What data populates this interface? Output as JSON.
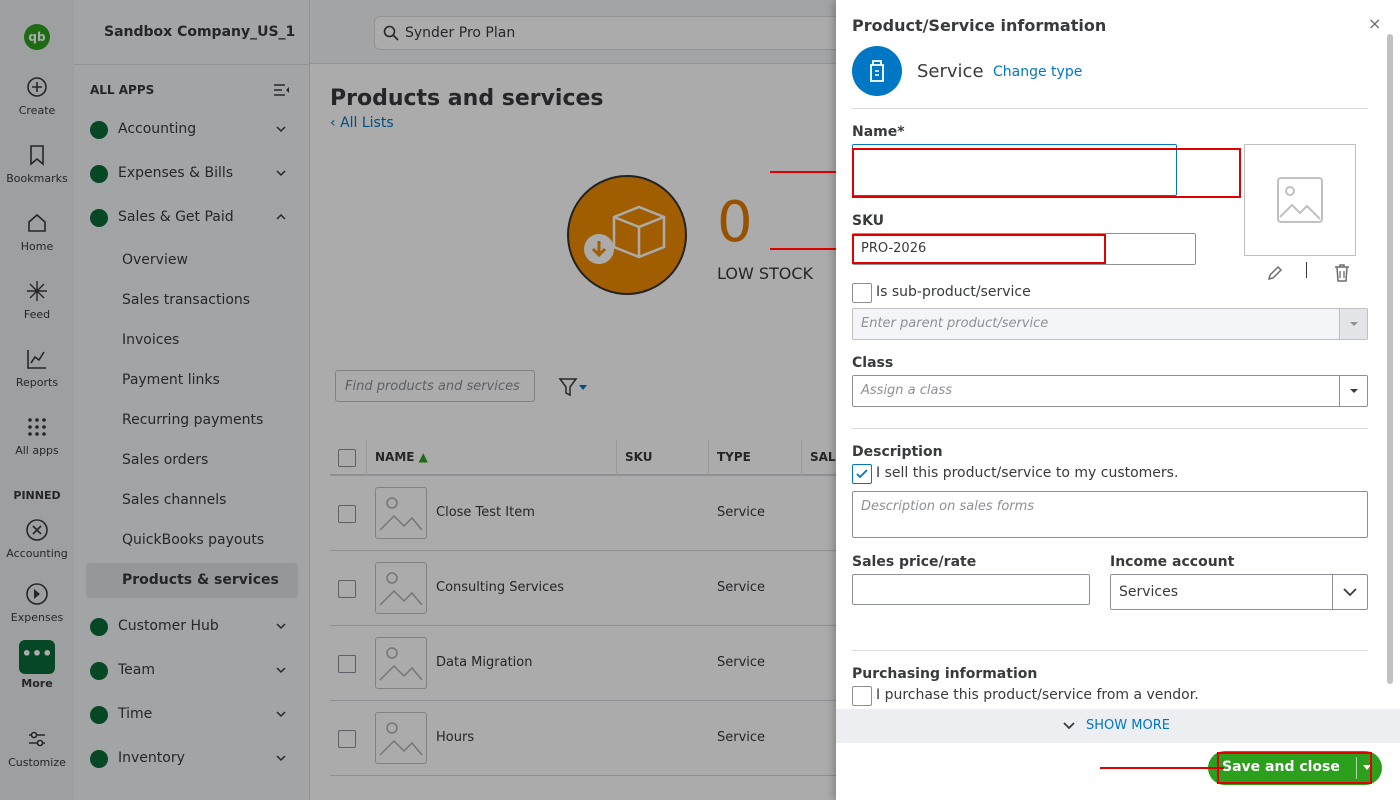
{
  "rail": {
    "logo": "qb",
    "create": "Create",
    "bookmarks": "Bookmarks",
    "home": "Home",
    "feed": "Feed",
    "reports": "Reports",
    "all_apps": "All apps",
    "pinned": "PINNED",
    "accounting": "Accounting",
    "expenses": "Expenses",
    "more": "More",
    "customize": "Customize"
  },
  "nav": {
    "company": "Sandbox Company_US_1",
    "all_apps": "ALL APPS",
    "groups": [
      {
        "label": "Accounting",
        "color": "#0a6b39"
      },
      {
        "label": "Expenses & Bills",
        "color": "#0a6b39"
      },
      {
        "label": "Sales & Get Paid",
        "color": "#0a6b39"
      },
      {
        "label": "Customer Hub",
        "color": "#0a6b39"
      },
      {
        "label": "Team",
        "color": "#0a6b39"
      },
      {
        "label": "Time",
        "color": "#0a6b39"
      },
      {
        "label": "Inventory",
        "color": "#0a6b39"
      }
    ],
    "sub": [
      "Overview",
      "Sales transactions",
      "Invoices",
      "Payment links",
      "Recurring payments",
      "Sales orders",
      "Sales channels",
      "QuickBooks payouts",
      "Products & services"
    ]
  },
  "search": {
    "text": "Synder Pro Plan"
  },
  "main": {
    "title": "Products and services",
    "back": "All Lists",
    "stock_count": "0",
    "stock_label": "LOW STOCK",
    "find_placeholder": "Find products and services",
    "columns": [
      "NAME",
      "SKU",
      "TYPE",
      "SAL"
    ],
    "rows": [
      {
        "name": "Close Test Item",
        "type": "Service"
      },
      {
        "name": "Consulting Services",
        "type": "Service"
      },
      {
        "name": "Data Migration",
        "type": "Service"
      },
      {
        "name": "Hours",
        "type": "Service"
      }
    ]
  },
  "drawer": {
    "title": "Product/Service information",
    "close": "×",
    "type": "Service",
    "change_type": "Change type",
    "name_label": "Name*",
    "name_value": "",
    "sku_label": "SKU",
    "sku_value": "PRO-2026",
    "sub_product": "Is sub-product/service",
    "parent_placeholder": "Enter parent product/service",
    "class_label": "Class",
    "class_placeholder": "Assign a class",
    "description_label": "Description",
    "sell_check": "I sell this product/service to my customers.",
    "desc_placeholder": "Description on sales forms",
    "price_label": "Sales price/rate",
    "price_value": "",
    "income_label": "Income account",
    "income_value": "Services",
    "purchasing_label": "Purchasing information",
    "purchase_check": "I purchase this product/service from a vendor.",
    "show_more": "SHOW MORE",
    "save": "Save and close"
  },
  "colors": {
    "brand": "#2ca01c",
    "link": "#0077c5",
    "annotation": "#e00000"
  }
}
